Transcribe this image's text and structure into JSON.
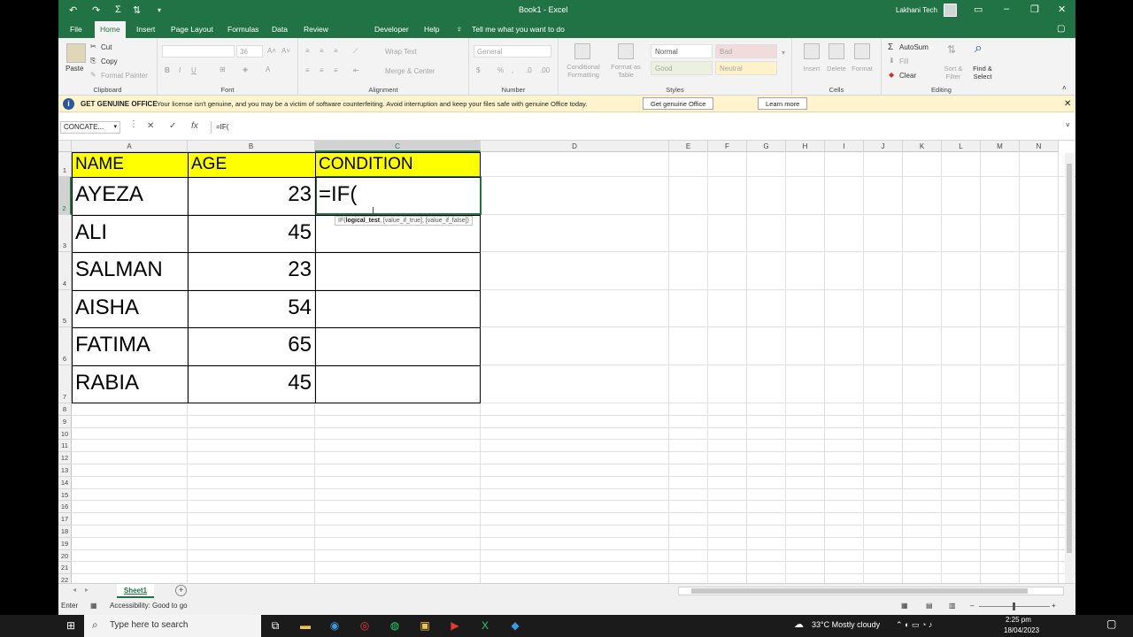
{
  "titlebar": {
    "title": "Book1 - Excel",
    "user": "Lakhani Tech"
  },
  "tabs": [
    "File",
    "Home",
    "Insert",
    "Page Layout",
    "Formulas",
    "Data",
    "Review",
    "Developer",
    "Help"
  ],
  "tell_me": "Tell me what you want to do",
  "ribbon": {
    "clipboard": {
      "paste": "Paste",
      "cut": "Cut",
      "copy": "Copy",
      "format_painter": "Format Painter",
      "label": "Clipboard"
    },
    "font": {
      "name": "",
      "size": "36",
      "label": "Font"
    },
    "alignment": {
      "wrap": "Wrap Text",
      "merge": "Merge & Center",
      "label": "Alignment"
    },
    "number": {
      "format": "General",
      "label": "Number"
    },
    "styles": {
      "conditional": "Conditional Formatting",
      "format_as_table": "Format as Table",
      "normal": "Normal",
      "bad": "Bad",
      "good": "Good",
      "neutral": "Neutral",
      "label": "Styles"
    },
    "cells": {
      "insert": "Insert",
      "delete": "Delete",
      "format": "Format",
      "label": "Cells"
    },
    "editing": {
      "autosum": "AutoSum",
      "fill": "Fill",
      "clear": "Clear",
      "sort": "Sort & Filter",
      "find": "Find & Select",
      "label": "Editing"
    }
  },
  "message": {
    "head": "GET GENUINE OFFICE",
    "body": "Your license isn't genuine, and you may be a victim of software counterfeiting. Avoid interruption and keep your files safe with genuine Office today.",
    "btn1": "Get genuine Office",
    "btn2": "Learn more"
  },
  "formula_bar": {
    "name_box": "CONCATE...",
    "formula": "=IF("
  },
  "columns": [
    "A",
    "B",
    "C",
    "D",
    "E",
    "F",
    "G",
    "H",
    "I",
    "J",
    "K",
    "L",
    "M",
    "N"
  ],
  "rows": [
    "1",
    "2",
    "3",
    "4",
    "5",
    "6",
    "7",
    "8",
    "9",
    "10",
    "11",
    "12",
    "13",
    "14",
    "15",
    "16",
    "17",
    "18",
    "19",
    "20",
    "21",
    "22"
  ],
  "table": {
    "headers": [
      "NAME",
      "AGE",
      "CONDITION"
    ],
    "data": [
      {
        "name": "AYEZA",
        "age": "23",
        "cond": "=IF("
      },
      {
        "name": "ALI",
        "age": "45",
        "cond": ""
      },
      {
        "name": "SALMAN",
        "age": "23",
        "cond": ""
      },
      {
        "name": "AISHA",
        "age": "54",
        "cond": ""
      },
      {
        "name": "FATIMA",
        "age": "65",
        "cond": ""
      },
      {
        "name": "RABIA",
        "age": "45",
        "cond": ""
      }
    ]
  },
  "tooltip": {
    "fn": "IF(",
    "arg1": "logical_test",
    "rest": ", [value_if_true], [value_if_false])"
  },
  "sheet_tab": "Sheet1",
  "status": {
    "mode": "Enter",
    "accessibility": "Accessibility: Good to go",
    "zoom": "100%"
  },
  "taskbar": {
    "search": "Type here to search",
    "weather": "33°C  Mostly cloudy",
    "time": "2:25 pm",
    "date": "18/04/2023"
  },
  "colors": {
    "excel_green": "#217346",
    "header_fill": "#ffff00",
    "message_bg": "#fff4ce"
  }
}
